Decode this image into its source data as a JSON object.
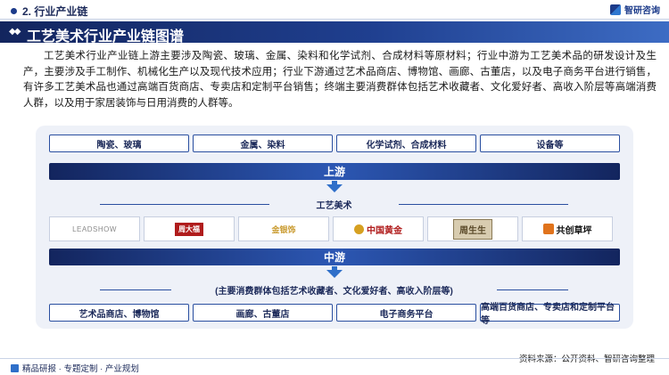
{
  "header": {
    "section_label": "2. 行业产业链",
    "logo_text": "智研咨询"
  },
  "title": "工艺美术行业产业链图谱",
  "intro": "工艺美术行业产业链上游主要涉及陶瓷、玻璃、金属、染料和化学试剂、合成材料等原材料；行业中游为工艺美术品的研发设计及生产，主要涉及手工制作、机械化生产以及现代技术应用；行业下游通过艺术品商店、博物馆、画廊、古董店，以及电子商务平台进行销售，有许多工艺美术品也通过高端百货商店、专卖店和定制平台销售；终端主要消费群体包括艺术收藏者、文化爱好者、高收入阶层等高端消费人群，以及用于家居装饰与日用消费的人群等。",
  "upstream": {
    "items": [
      "陶瓷、玻璃",
      "金属、染料",
      "化学试剂、合成材料",
      "设备等"
    ],
    "label": "上游"
  },
  "midstream": {
    "title": "工艺美术",
    "brands": [
      "LEADSHOW",
      "周大福",
      "金银饰",
      "中国黄金",
      "周生生",
      "共创草坪"
    ],
    "label": "中游"
  },
  "downstream": {
    "consumer_note": "(主要消费群体包括艺术收藏者、文化爱好者、高收入阶层等)",
    "items": [
      "艺术品商店、博物馆",
      "画廊、古董店",
      "电子商务平台",
      "高端百货商店、专卖店和定制平台等"
    ]
  },
  "footer": {
    "left": "精品研报 · 专题定制 · 产业规划",
    "source": "资料来源：公开资料、智研咨询整理"
  },
  "colors": {
    "primary_dark": "#13255e",
    "primary": "#1f3f8f",
    "accent": "#2f6fc9",
    "panel_bg": "#eef1f8"
  }
}
